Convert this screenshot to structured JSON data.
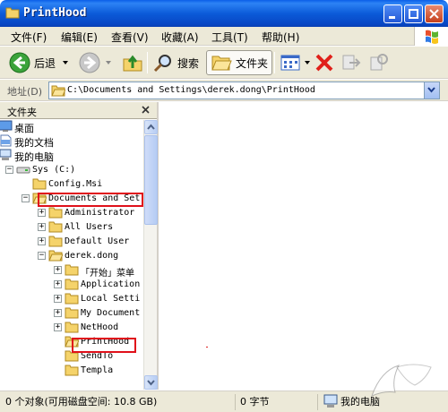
{
  "window": {
    "title": "PrintHood"
  },
  "menu": {
    "items": [
      "文件(F)",
      "编辑(E)",
      "查看(V)",
      "收藏(A)",
      "工具(T)",
      "帮助(H)"
    ]
  },
  "toolbar": {
    "back_label": "后退",
    "search_label": "搜索",
    "folders_label": "文件夹"
  },
  "address": {
    "label": "地址(D)",
    "value": "C:\\Documents and Settings\\derek.dong\\PrintHood"
  },
  "folder_pane": {
    "title": "文件夹",
    "tree": [
      {
        "label": "桌面",
        "indent": 0,
        "expander": "",
        "icon": "desktop-icon"
      },
      {
        "label": "我的文档",
        "indent": 0,
        "expander": "",
        "icon": "my-documents-icon"
      },
      {
        "label": "我的电脑",
        "indent": 0,
        "expander": "",
        "icon": "my-computer-icon"
      },
      {
        "label": "Sys (C:)",
        "indent": 1,
        "expander": "−",
        "icon": "drive-icon"
      },
      {
        "label": "Config.Msi",
        "indent": 2,
        "expander": "",
        "icon": "folder-icon"
      },
      {
        "label": "Documents and Set",
        "indent": 2,
        "expander": "−",
        "icon": "folder-open-icon"
      },
      {
        "label": "Administrator",
        "indent": 3,
        "expander": "+",
        "icon": "folder-icon"
      },
      {
        "label": "All Users",
        "indent": 3,
        "expander": "+",
        "icon": "folder-icon"
      },
      {
        "label": "Default User",
        "indent": 3,
        "expander": "+",
        "icon": "folder-icon"
      },
      {
        "label": "derek.dong",
        "indent": 3,
        "expander": "−",
        "icon": "folder-open-icon"
      },
      {
        "label": "「开始」菜单",
        "indent": 4,
        "expander": "+",
        "icon": "folder-icon"
      },
      {
        "label": "Application",
        "indent": 4,
        "expander": "+",
        "icon": "folder-icon"
      },
      {
        "label": "Local Setti",
        "indent": 4,
        "expander": "+",
        "icon": "folder-icon"
      },
      {
        "label": "My Document",
        "indent": 4,
        "expander": "+",
        "icon": "folder-icon"
      },
      {
        "label": "NetHood",
        "indent": 4,
        "expander": "+",
        "icon": "folder-icon"
      },
      {
        "label": "PrintHood",
        "indent": 4,
        "expander": "",
        "icon": "folder-open-icon"
      },
      {
        "label": "SendTo",
        "indent": 4,
        "expander": "",
        "icon": "folder-icon"
      },
      {
        "label": "Templa",
        "indent": 4,
        "expander": "",
        "icon": "folder-icon"
      }
    ]
  },
  "status": {
    "objects": "0 个对象(可用磁盘空间: 10.8 GB)",
    "size": "0 字节",
    "location": "我的电脑"
  },
  "colors": {
    "highlight": "#e0101a",
    "titlebar": "#0b5bd9"
  }
}
